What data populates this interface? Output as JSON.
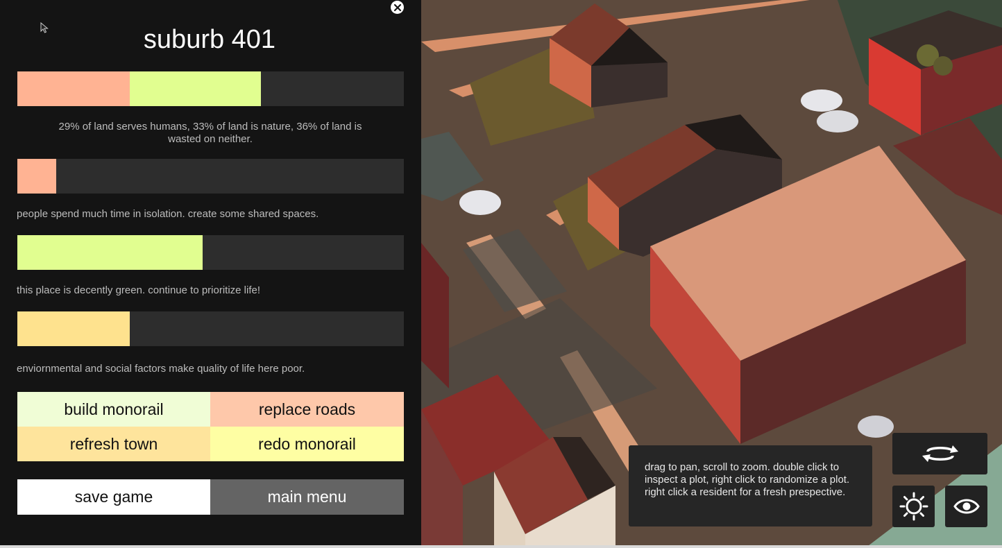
{
  "title": "suburb 401",
  "land": {
    "segments": [
      {
        "name": "humans",
        "fraction": 0.29,
        "color": "#ffb393"
      },
      {
        "name": "nature",
        "fraction": 0.34,
        "color": "#e1fe90"
      },
      {
        "name": "wasted",
        "fraction": 0.37,
        "color": "#2d2d2d"
      }
    ],
    "text": "29% of land serves humans, 33% of land is nature, 36% of land is wasted on neither."
  },
  "meters": [
    {
      "key": "social",
      "fraction": 0.1,
      "color": "#ffb393",
      "text": "people spend much time in isolation. create some shared spaces."
    },
    {
      "key": "green",
      "fraction": 0.48,
      "color": "#e1fe90",
      "text": "this place is decently green. continue to prioritize life!"
    },
    {
      "key": "quality",
      "fraction": 0.29,
      "color": "#fee28e",
      "text": "enviornmental and social factors make quality of life here poor."
    }
  ],
  "actions": {
    "build_monorail": "build monorail",
    "replace_roads": "replace roads",
    "refresh_town": "refresh town",
    "redo_monorail": "redo monorail",
    "save_game": "save game",
    "main_menu": "main menu"
  },
  "colors": {
    "build_monorail": "#f0fdd6",
    "replace_roads": "#fec8aa",
    "refresh_town": "#fee49c",
    "redo_monorail": "#fefea3",
    "save_game": "#ffffff",
    "main_menu": "#646464"
  },
  "help": "drag to pan, scroll to zoom. double click to inspect a plot, right click to randomize a plot. right click a resident for a fresh prespective.",
  "icons": {
    "close": "close-icon",
    "rotate": "rotate-icon",
    "daylight": "sun-icon",
    "view": "eye-icon"
  }
}
